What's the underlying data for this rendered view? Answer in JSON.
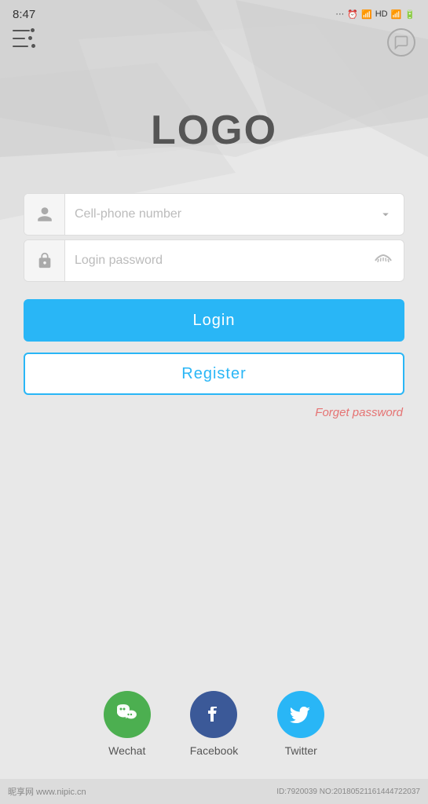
{
  "statusBar": {
    "time": "8:47",
    "dots": "···",
    "indicators": "HD"
  },
  "logo": {
    "text": "LOGO"
  },
  "form": {
    "phoneField": {
      "placeholder": "Cell-phone number"
    },
    "passwordField": {
      "placeholder": "Login password"
    },
    "loginButton": "Login",
    "registerButton": "Register",
    "forgetPassword": "Forget password"
  },
  "social": [
    {
      "id": "wechat",
      "label": "Wechat",
      "class": "wechat"
    },
    {
      "id": "facebook",
      "label": "Facebook",
      "class": "facebook"
    },
    {
      "id": "twitter",
      "label": "Twitter",
      "class": "twitter"
    }
  ],
  "watermark": {
    "left": "昵享网 www.nipic.cn",
    "right": "ID:7920039 NO:20180521161444722037"
  }
}
